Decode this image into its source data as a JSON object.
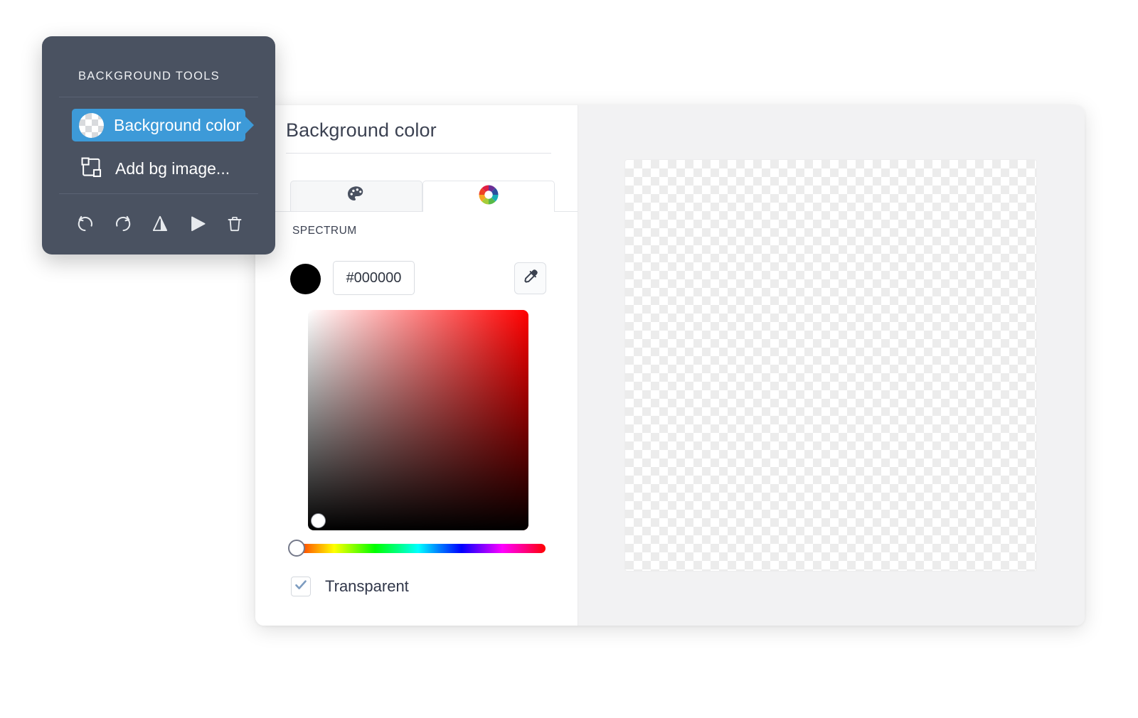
{
  "toolbox": {
    "title": "BACKGROUND TOOLS",
    "items": [
      {
        "id": "background-color",
        "label": "Background color",
        "icon": "checkerboard-circle-icon",
        "selected": true
      },
      {
        "id": "add-bg-image",
        "label": "Add bg image...",
        "icon": "image-frame-icon",
        "selected": false
      }
    ],
    "actions": [
      {
        "id": "undo",
        "label": "Undo",
        "icon": "undo-icon"
      },
      {
        "id": "redo",
        "label": "Redo",
        "icon": "redo-icon"
      },
      {
        "id": "flip-horizontal",
        "label": "Flip horizontal",
        "icon": "flip-horizontal-icon"
      },
      {
        "id": "flip-vertical",
        "label": "Flip vertical",
        "icon": "flip-vertical-icon"
      },
      {
        "id": "delete",
        "label": "Delete",
        "icon": "trash-icon"
      }
    ],
    "accent_color": "#3d9ad8",
    "panel_color": "#4a5261"
  },
  "panel": {
    "title": "Background color",
    "tabs": [
      {
        "id": "palette",
        "icon": "palette-icon",
        "active": false
      },
      {
        "id": "spectrum",
        "icon": "color-wheel-icon",
        "active": true
      }
    ],
    "section_label": "SPECTRUM",
    "color": {
      "swatch_hex": "#000000",
      "hex_value": "#000000",
      "hex_placeholder": "#000000"
    },
    "eyedropper": {
      "icon": "eyedropper-icon",
      "label": "Pick color from image"
    },
    "spectrum": {
      "hue_degrees": 0,
      "hue_hex": "#ff0000",
      "saturation_percent": 0,
      "value_percent": 0
    },
    "transparent": {
      "label": "Transparent",
      "checked": true,
      "check_color": "#7d9cc0"
    }
  },
  "canvas": {
    "background": "transparent-checkerboard",
    "surface_color": "#f2f2f3"
  }
}
